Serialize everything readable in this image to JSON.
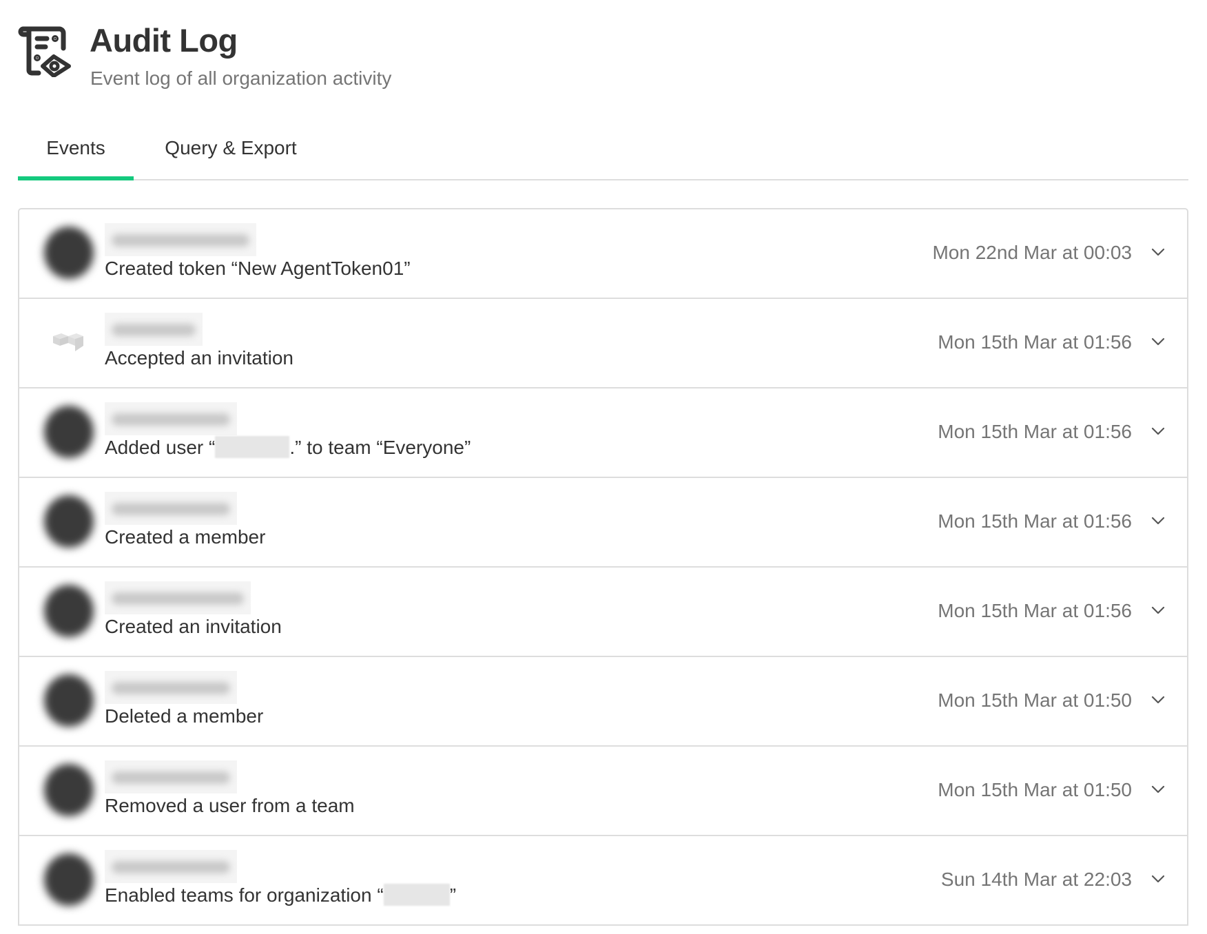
{
  "header": {
    "icon": "audit-log-scroll-eye-icon",
    "title": "Audit Log",
    "subtitle": "Event log of all organization activity"
  },
  "tabs": [
    {
      "label": "Events",
      "active": true
    },
    {
      "label": "Query & Export",
      "active": false
    }
  ],
  "colors": {
    "accent": "#15c97e",
    "text_primary": "#333333",
    "text_secondary": "#757575",
    "border": "#dddddd"
  },
  "events": [
    {
      "avatar": "user-photo-blurred",
      "actor": "[blurred]",
      "text_before": "Created token “New AgentToken01”",
      "redacted": false,
      "text_after": "",
      "time": "Mon 22nd Mar at 00:03",
      "expand_icon": "chevron-down-icon"
    },
    {
      "avatar": "logo-blocks",
      "actor": "[blurred]",
      "text_before": "Accepted an invitation",
      "redacted": false,
      "text_after": "",
      "time": "Mon 15th Mar at 01:56",
      "expand_icon": "chevron-down-icon"
    },
    {
      "avatar": "user-photo-blurred",
      "actor": "[blurred]",
      "text_before": "Added user “",
      "redacted": true,
      "text_after": ".” to team “Everyone”",
      "time": "Mon 15th Mar at 01:56",
      "expand_icon": "chevron-down-icon"
    },
    {
      "avatar": "user-photo-blurred",
      "actor": "[blurred]",
      "text_before": "Created a member",
      "redacted": false,
      "text_after": "",
      "time": "Mon 15th Mar at 01:56",
      "expand_icon": "chevron-down-icon"
    },
    {
      "avatar": "user-photo-blurred",
      "actor": "[blurred]",
      "text_before": "Created an invitation",
      "redacted": false,
      "text_after": "",
      "time": "Mon 15th Mar at 01:56",
      "expand_icon": "chevron-down-icon"
    },
    {
      "avatar": "user-photo-blurred",
      "actor": "[blurred]",
      "text_before": "Deleted a member",
      "redacted": false,
      "text_after": "",
      "time": "Mon 15th Mar at 01:50",
      "expand_icon": "chevron-down-icon"
    },
    {
      "avatar": "user-photo-blurred",
      "actor": "[blurred]",
      "text_before": "Removed a user from a team",
      "redacted": false,
      "text_after": "",
      "time": "Mon 15th Mar at 01:50",
      "expand_icon": "chevron-down-icon"
    },
    {
      "avatar": "user-photo-blurred",
      "actor": "[blurred]",
      "text_before": "Enabled teams for organization “",
      "redacted": true,
      "text_after": "”",
      "time": "Sun 14th Mar at 22:03",
      "expand_icon": "chevron-down-icon"
    }
  ]
}
